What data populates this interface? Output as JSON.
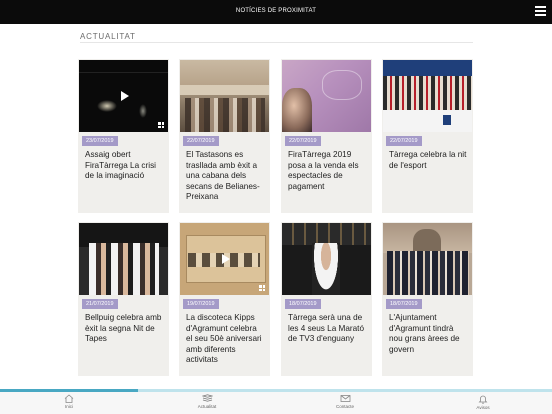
{
  "header": {
    "title": "NOTÍCIES DE PROXIMITAT",
    "menu_icon": "hamburger-icon"
  },
  "section": {
    "title": "ACTUALITAT"
  },
  "cards": [
    {
      "date": "23/07/2019",
      "headline": "Assaig obert FiraTàrrega La crisi de la imaginació",
      "media": "video"
    },
    {
      "date": "22/07/2019",
      "headline": "El Tastasons es trasllada amb èxit a una cabana dels secans de Belianes-Preixana",
      "media": "photo"
    },
    {
      "date": "22/07/2019",
      "headline": "FiraTàrrega 2019 posa a la venda els espectacles de pagament",
      "media": "photo"
    },
    {
      "date": "22/07/2019",
      "headline": "Tàrrega celebra la nit de l'esport",
      "media": "photo"
    },
    {
      "date": "21/07/2019",
      "headline": "Bellpuig celebra amb èxit la segna Nit de Tapes",
      "media": "photo"
    },
    {
      "date": "19/07/2019",
      "headline": "La discoteca Kipps d'Agramunt celebra el seu 50è aniversari amb diferents activitats",
      "media": "video"
    },
    {
      "date": "18/07/2019",
      "headline": "Tàrrega serà una de les 4 seus La Marató de TV3 d'enguany",
      "media": "photo"
    },
    {
      "date": "18/07/2019",
      "headline": "L'Ajuntament d'Agramunt tindrà nou grans àrees de govern",
      "media": "photo"
    }
  ],
  "tabs": [
    {
      "label": "Inici",
      "icon": "home-icon"
    },
    {
      "label": "Actualitat",
      "icon": "newspaper-icon"
    },
    {
      "label": "Contacte",
      "icon": "mail-icon"
    },
    {
      "label": "Avisos",
      "icon": "bell-icon"
    }
  ]
}
